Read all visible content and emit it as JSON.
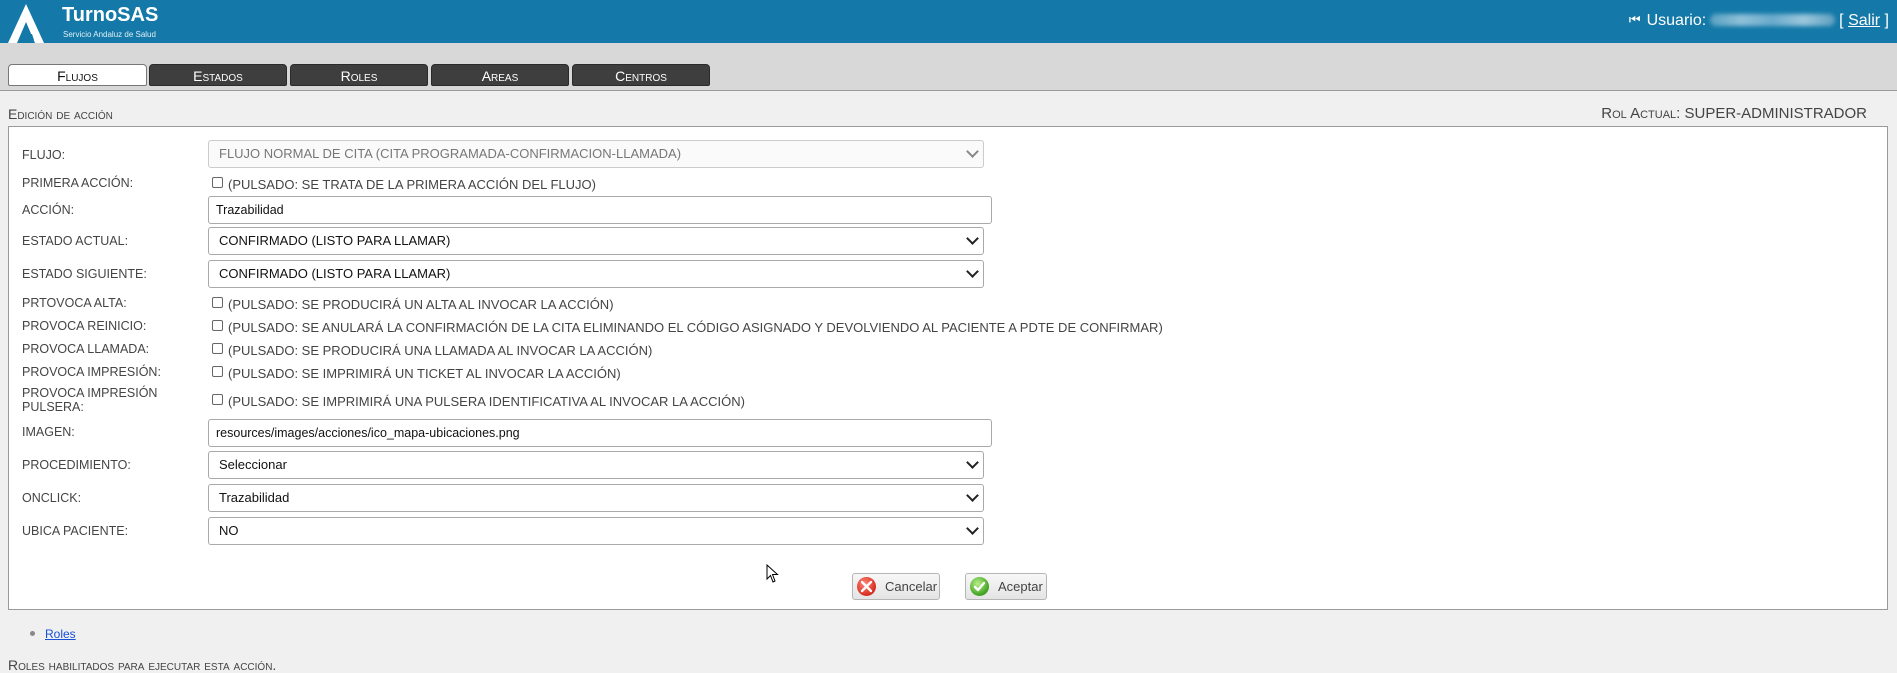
{
  "header": {
    "brand": "TurnoSAS",
    "brand_sub": "Servicio Andaluz de Salud",
    "user_label": "Usuario:",
    "logout_open": "[",
    "logout_label": "Salir",
    "logout_close": "]"
  },
  "tabs": [
    {
      "label": "Flujos",
      "active": true
    },
    {
      "label": "Estados"
    },
    {
      "label": "Roles"
    },
    {
      "label": "Areas"
    },
    {
      "label": "Centros"
    }
  ],
  "page": {
    "section_title": "Edición de acción",
    "role_actual": "Rol Actual: SUPER-ADMINISTRADOR"
  },
  "form": {
    "flujo": {
      "label": "FLUJO:",
      "value": "FLUJO NORMAL DE CITA (CITA PROGRAMADA-CONFIRMACION-LLAMADA)"
    },
    "primera_accion": {
      "label": "PRIMERA ACCIÓN:",
      "text": "(PULSADO: SE TRATA DE LA PRIMERA ACCIÓN DEL FLUJO)",
      "checked": false
    },
    "accion": {
      "label": "ACCIÓN:",
      "value": "Trazabilidad"
    },
    "estado_actual": {
      "label": "ESTADO ACTUAL:",
      "value": "CONFIRMADO (LISTO PARA LLAMAR)"
    },
    "estado_siguiente": {
      "label": "ESTADO SIGUIENTE:",
      "value": "CONFIRMADO (LISTO PARA LLAMAR)"
    },
    "provoca_alta": {
      "label": "PRTOVOCA ALTA:",
      "text": "(PULSADO: SE PRODUCIRÁ UN ALTA AL INVOCAR LA ACCIÓN)",
      "checked": false
    },
    "provoca_reinicio": {
      "label": "PROVOCA REINICIO:",
      "text": "(PULSADO: SE ANULARÁ LA CONFIRMACIÓN DE LA CITA ELIMINANDO EL CÓDIGO ASIGNADO Y DEVOLVIENDO AL PACIENTE A PDTE DE CONFIRMAR)",
      "checked": false
    },
    "provoca_llamada": {
      "label": "PROVOCA LLAMADA:",
      "text": "(PULSADO: SE PRODUCIRÁ UNA LLAMADA AL INVOCAR LA ACCIÓN)",
      "checked": false
    },
    "provoca_impresion": {
      "label": "PROVOCA IMPRESIÓN:",
      "text": "(PULSADO: SE IMPRIMIRÁ UN TICKET AL INVOCAR LA ACCIÓN)",
      "checked": false
    },
    "provoca_impresion_pulsera": {
      "label_1": "PROVOCA IMPRESIÓN",
      "label_2": "PULSERA:",
      "text": "(PULSADO: SE IMPRIMIRÁ UNA PULSERA IDENTIFICATIVA AL INVOCAR LA ACCIÓN)",
      "checked": false
    },
    "imagen": {
      "label": "IMAGEN:",
      "value": "resources/images/acciones/ico_mapa-ubicaciones.png"
    },
    "procedimiento": {
      "label": "PROCEDIMIENTO:",
      "value": "Seleccionar"
    },
    "onclick": {
      "label": "ONCLICK:",
      "value": "Trazabilidad"
    },
    "ubica_paciente": {
      "label": "UBICA PACIENTE:",
      "value": "NO"
    }
  },
  "buttons": {
    "cancel": "Cancelar",
    "accept": "Aceptar"
  },
  "footer": {
    "roles_link": "Roles",
    "roles_caption": "Roles habilitados para ejecutar esta acción."
  },
  "colors": {
    "header_bg": "#1479a8",
    "tab_bg": "#3e3e3e"
  }
}
